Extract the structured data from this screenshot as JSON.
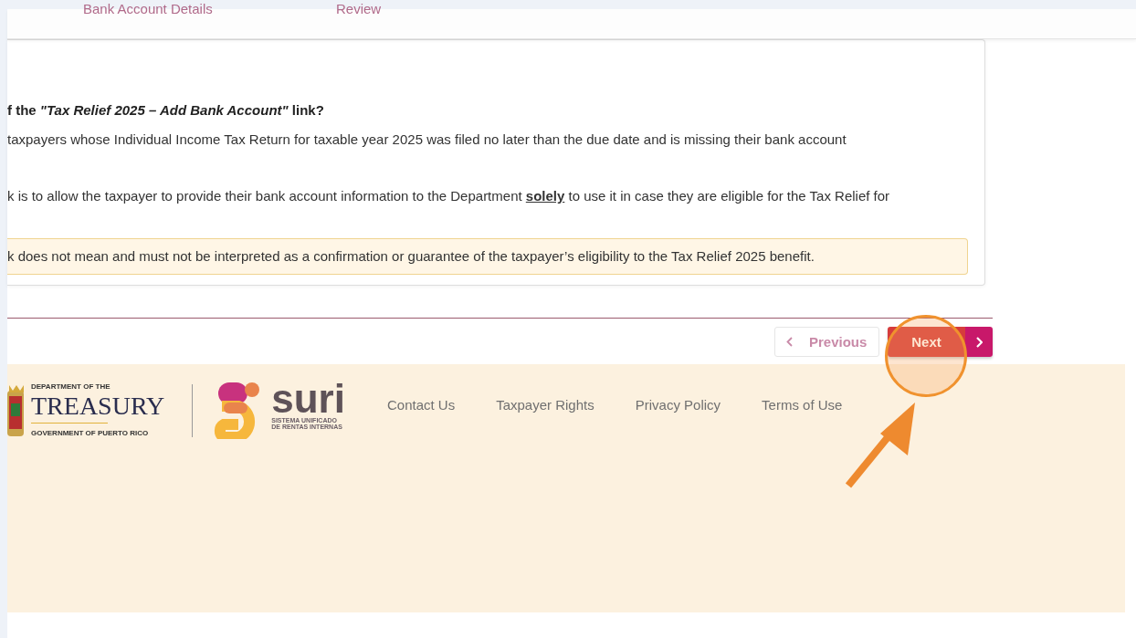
{
  "steps": [
    {
      "label": "Bank Account Details"
    },
    {
      "label": "Review"
    }
  ],
  "card": {
    "heading": "f the *\"Tax Relief 2025 – Add Bank Account\"* link?",
    "paragraphs": [
      "taxpayers whose Individual Income Tax Return for taxable year 2025 was filed no later than the due date and is missing their bank account",
      "k is to allow the taxpayer to provide their bank account information to the Department **solely** to use it in case they are eligible for the Tax Relief for"
    ],
    "notice": "k does not mean and must not be interpreted as a confirmation or guarantee of the taxpayer’s eligibility to the Tax Relief 2025 benefit."
  },
  "nav": {
    "previous": "Previous",
    "next": "Next"
  },
  "footer": {
    "treasury": {
      "top": "DEPARTMENT OF THE",
      "name": "TREASURY",
      "bottom": "GOVERNMENT OF PUERTO RICO"
    },
    "suri": {
      "name": "suri",
      "line1": "SISTEMA UNIFICADO",
      "line2": "DE RENTAS INTERNAS"
    },
    "links": [
      "Contact Us",
      "Taxpayer Rights",
      "Privacy Policy",
      "Terms of Use"
    ]
  }
}
